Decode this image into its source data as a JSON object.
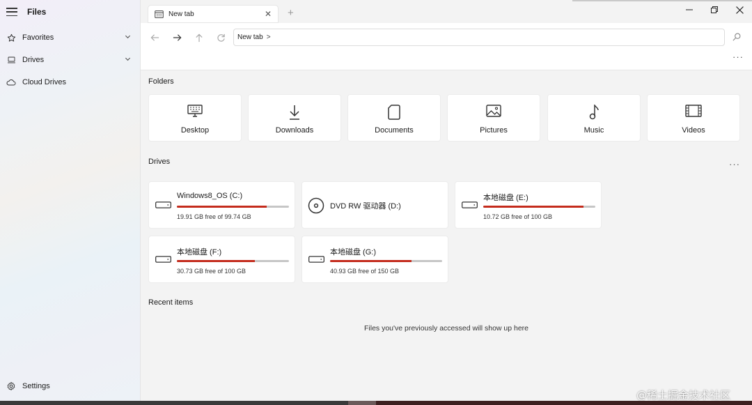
{
  "app": {
    "title": "Files"
  },
  "sidebar": {
    "items": [
      {
        "label": "Favorites",
        "icon": "star-icon",
        "expandable": true
      },
      {
        "label": "Drives",
        "icon": "drive-icon",
        "expandable": true
      },
      {
        "label": "Cloud Drives",
        "icon": "cloud-icon",
        "expandable": false
      }
    ],
    "settings_label": "Settings"
  },
  "tabs": [
    {
      "label": "New tab",
      "icon": "tab-page-icon",
      "active": true
    }
  ],
  "window_controls": {
    "minimize": "—",
    "restore": "❐",
    "close": "✕"
  },
  "toolbar": {
    "back_icon": "arrow-left-icon",
    "forward_icon": "arrow-right-icon",
    "up_icon": "arrow-up-icon",
    "refresh_icon": "refresh-icon",
    "breadcrumb": [
      "New tab"
    ],
    "breadcrumb_separator": ">",
    "search_icon": "search-icon",
    "more_label": "···"
  },
  "sections": {
    "folders_title": "Folders",
    "drives_title": "Drives",
    "recent_title": "Recent items",
    "drives_more_label": "···"
  },
  "folders": [
    {
      "name": "Desktop",
      "icon": "desktop-icon"
    },
    {
      "name": "Downloads",
      "icon": "download-icon"
    },
    {
      "name": "Documents",
      "icon": "document-icon"
    },
    {
      "name": "Pictures",
      "icon": "picture-icon"
    },
    {
      "name": "Music",
      "icon": "music-note-icon"
    },
    {
      "name": "Videos",
      "icon": "film-icon"
    }
  ],
  "drives": [
    {
      "name": "Windows8_OS (C:)",
      "free_text": "19.91 GB free of 99.74 GB",
      "used_fraction": 0.8,
      "type": "hdd"
    },
    {
      "name": "DVD RW 驱动器 (D:)",
      "free_text": "",
      "used_fraction": null,
      "type": "dvd"
    },
    {
      "name": "本地磁盘 (E:)",
      "free_text": "10.72 GB free of 100 GB",
      "used_fraction": 0.893,
      "type": "hdd"
    },
    {
      "name": "本地磁盘 (F:)",
      "free_text": "30.73 GB free of 100 GB",
      "used_fraction": 0.693,
      "type": "hdd"
    },
    {
      "name": "本地磁盘 (G:)",
      "free_text": "40.93 GB free of 150 GB",
      "used_fraction": 0.727,
      "type": "hdd"
    }
  ],
  "recent": {
    "empty_message": "Files you've previously accessed will show up here"
  },
  "colors": {
    "usage_bar": "#c42b1c",
    "track": "#c6c6c6",
    "accent": "#0067c0"
  },
  "watermark": "@稀土掘金技术社区"
}
